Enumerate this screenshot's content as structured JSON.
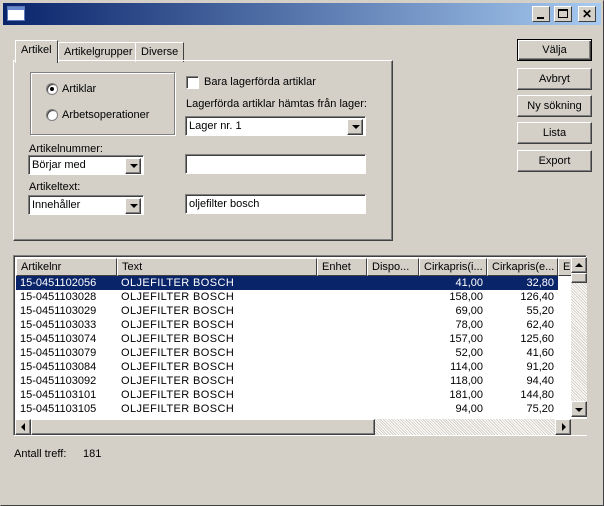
{
  "window": {
    "title": ""
  },
  "tabs": [
    {
      "label": "Artikel",
      "active": true
    },
    {
      "label": "Artikelgrupper",
      "active": false
    },
    {
      "label": "Diverse",
      "active": false
    }
  ],
  "search_type": {
    "options": [
      "Artiklar",
      "Arbetsoperationer"
    ],
    "selected": "Artiklar"
  },
  "stock_only": {
    "label": "Bara lagerförda artiklar",
    "checked": false
  },
  "warehouse": {
    "label": "Lagerförda artiklar hämtas från lager:",
    "value": "Lager nr. 1"
  },
  "article_number": {
    "label": "Artikelnummer:",
    "mode": "Börjar med",
    "value": ""
  },
  "article_text": {
    "label": "Artikeltext:",
    "mode": "Innehåller",
    "value": "oljefilter bosch"
  },
  "buttons": {
    "select": "Välja",
    "cancel": "Avbryt",
    "new_search": "Ny sökning",
    "list": "Lista",
    "export": "Export"
  },
  "results": {
    "columns": [
      "Artikelnr",
      "Text",
      "Enhet",
      "Dispo...",
      "Cirkapris(i...",
      "Cirkapris(e...",
      "E"
    ],
    "rows": [
      [
        "15-0451102056",
        "OLJEFILTER BOSCH",
        "",
        "",
        "41,00",
        "32,80"
      ],
      [
        "15-0451103028",
        "OLJEFILTER BOSCH",
        "",
        "",
        "158,00",
        "126,40"
      ],
      [
        "15-0451103029",
        "OLJEFILTER BOSCH",
        "",
        "",
        "69,00",
        "55,20"
      ],
      [
        "15-0451103033",
        "OLJEFILTER BOSCH",
        "",
        "",
        "78,00",
        "62,40"
      ],
      [
        "15-0451103074",
        "OLJEFILTER BOSCH",
        "",
        "",
        "157,00",
        "125,60"
      ],
      [
        "15-0451103079",
        "OLJEFILTER BOSCH",
        "",
        "",
        "52,00",
        "41,60"
      ],
      [
        "15-0451103084",
        "OLJEFILTER BOSCH",
        "",
        "",
        "114,00",
        "91,20"
      ],
      [
        "15-0451103092",
        "OLJEFILTER BOSCH",
        "",
        "",
        "118,00",
        "94,40"
      ],
      [
        "15-0451103101",
        "OLJEFILTER BOSCH",
        "",
        "",
        "181,00",
        "144,80"
      ],
      [
        "15-0451103105",
        "OLJEFILTER BOSCH",
        "",
        "",
        "94,00",
        "75,20"
      ]
    ],
    "selected_row": 0
  },
  "footer": {
    "count_label": "Antall treff:",
    "count_value": "181"
  },
  "colors": {
    "selection": "#0a246a",
    "titlebar_start": "#0a246a",
    "titlebar_end": "#a6caf0",
    "face": "#d4d0c8"
  }
}
